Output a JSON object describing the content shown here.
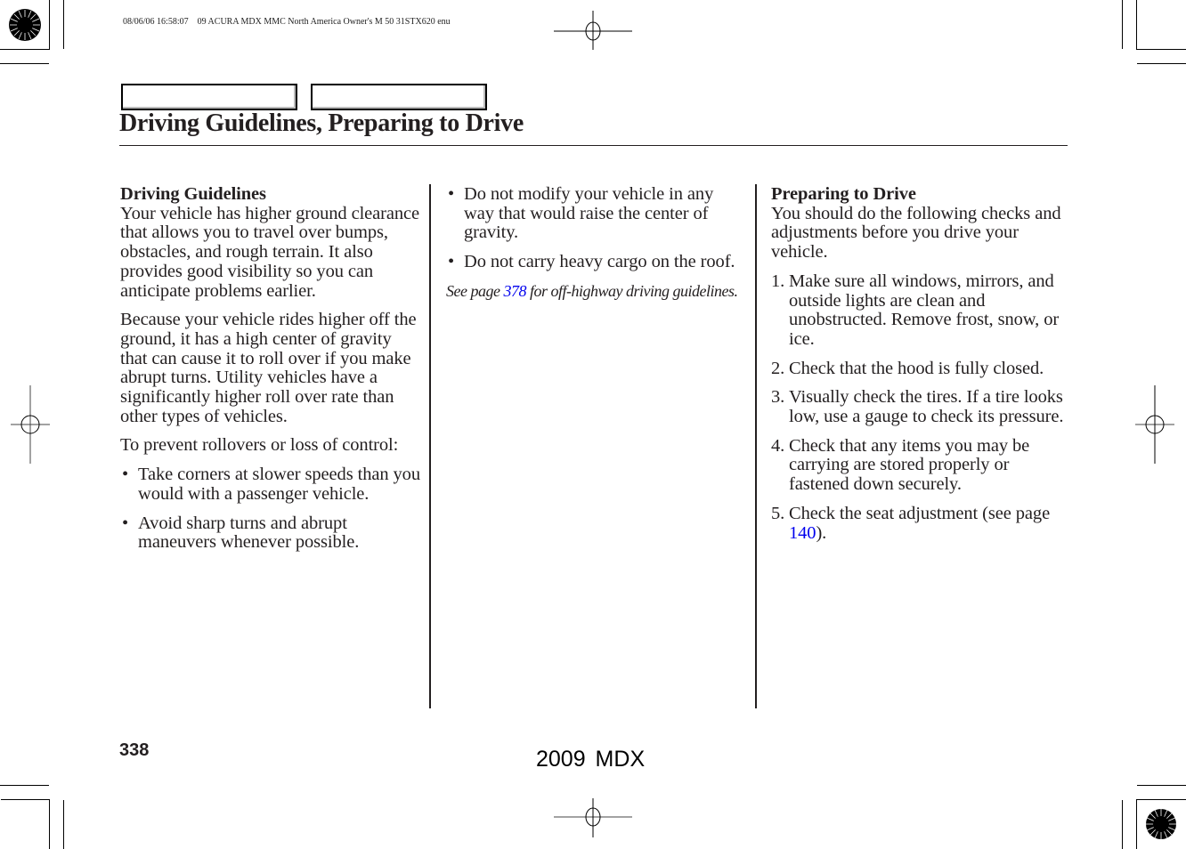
{
  "print_info": "08/06/06 16:58:07    09 ACURA MDX MMC North America Owner's M 50 31STX620 enu",
  "header": {
    "tabs": [
      {
        "label": ""
      },
      {
        "label": ""
      }
    ],
    "title": "Driving Guidelines, Preparing to Drive"
  },
  "column1": {
    "heading": "Driving Guidelines",
    "paragraphs": [
      "Your vehicle has higher ground clearance that allows you to travel over bumps, obstacles, and rough terrain. It also provides good visibility so you can anticipate problems earlier.",
      "Because your vehicle rides higher off the ground, it has a high center of gravity that can cause it to roll over if you make abrupt turns. Utility vehicles have a significantly higher roll over rate than other types of vehicles.",
      "To prevent rollovers or loss of control:"
    ],
    "bullets": [
      "Take corners at slower speeds than you would with a passenger vehicle.",
      "Avoid sharp turns and abrupt maneuvers whenever possible."
    ]
  },
  "column2": {
    "bullets": [
      "Do not modify your vehicle in any way that would raise the center of gravity.",
      "Do not carry heavy cargo on the roof."
    ],
    "note": {
      "prefix": "See page ",
      "link": "378",
      "suffix": " for off-highway driving guidelines."
    }
  },
  "column3": {
    "heading": "Preparing to Drive",
    "intro": "You should do the following checks and adjustments before you drive your vehicle.",
    "steps": [
      {
        "num": "1.",
        "text": "Make sure all windows, mirrors, and outside lights are clean and unobstructed. Remove frost, snow, or ice."
      },
      {
        "num": "2.",
        "text": "Check that the hood is fully closed."
      },
      {
        "num": "3.",
        "text": "Visually check the tires. If a tire looks low, use a gauge to check its pressure."
      },
      {
        "num": "4.",
        "text": "Check that any items you may be carrying are stored properly or fastened down securely."
      },
      {
        "num": "5.",
        "text_prefix": "Check the seat adjustment (see page ",
        "link": "140",
        "text_suffix": ")."
      }
    ]
  },
  "bullet_glyph": "•",
  "footer": {
    "page_number": "338",
    "model": "2009  MDX"
  },
  "colors": {
    "text": "#231f20",
    "link": "#0000ee"
  }
}
